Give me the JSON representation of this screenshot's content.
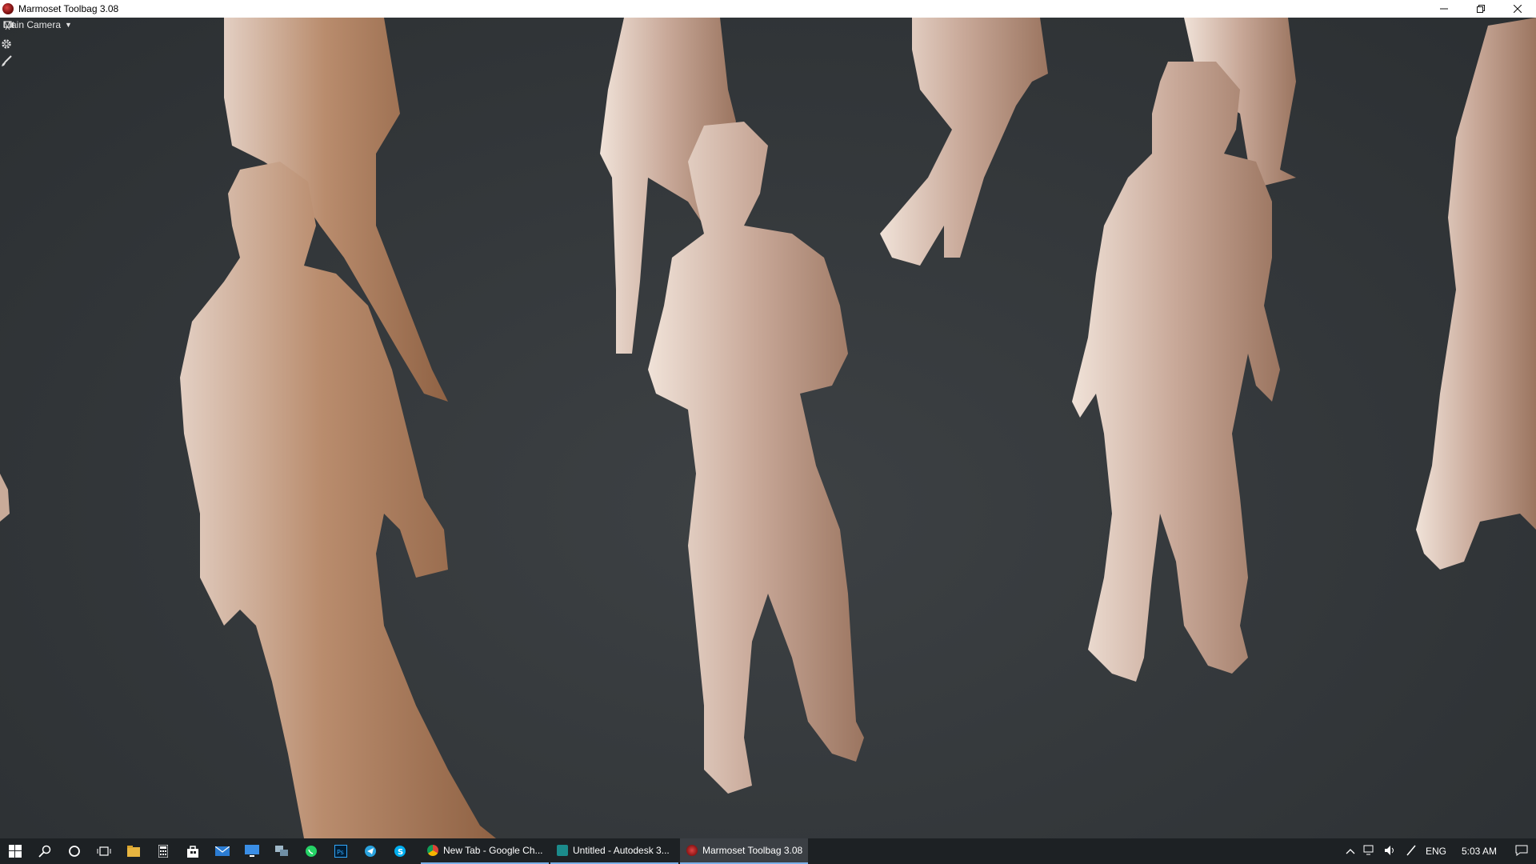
{
  "window": {
    "title": "Marmoset Toolbag 3.08",
    "controls": {
      "minimize_icon": "minimize-icon",
      "maximize_icon": "restore-icon",
      "close_icon": "close-icon"
    }
  },
  "viewport": {
    "camera_label": "Main Camera",
    "tools": [
      "settings-gear-icon",
      "paint-brush-icon"
    ],
    "colors": {
      "background": "#34383b",
      "figure_light": "#d9c3b6",
      "figure_mid": "#b88a6b",
      "figure_dark": "#8a5d3e"
    }
  },
  "taskbar": {
    "pinned": [
      "windows-start-icon",
      "search-icon",
      "cortana-icon",
      "task-view-icon",
      "file-explorer-icon",
      "calculator-icon",
      "store-icon",
      "mail-icon",
      "remote-desktop-icon",
      "network-icon",
      "whatsapp-icon",
      "photoshop-icon",
      "telegram-icon",
      "skype-icon"
    ],
    "apps": [
      {
        "label": "New Tab - Google Ch...",
        "icon": "chrome-icon",
        "active": false
      },
      {
        "label": "Untitled - Autodesk 3...",
        "icon": "3dsmax-icon",
        "active": false
      },
      {
        "label": "Marmoset Toolbag 3.08",
        "icon": "marmoset-icon",
        "active": true
      }
    ],
    "tray": {
      "language": "ENG",
      "time": "5:03 AM"
    }
  }
}
